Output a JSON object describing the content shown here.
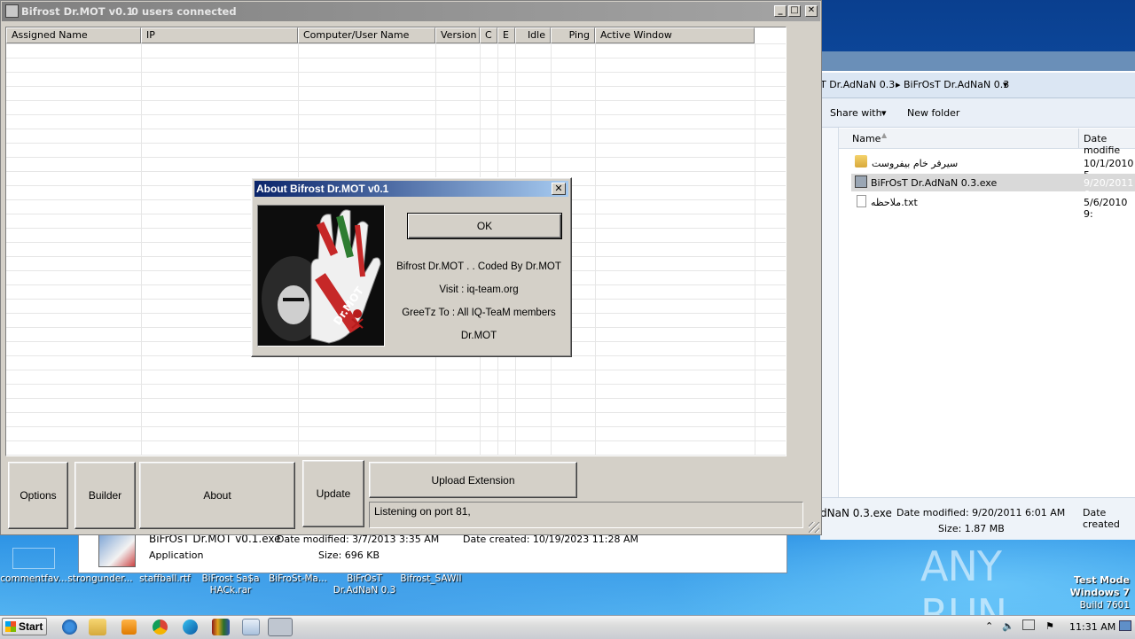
{
  "main_window": {
    "title": "Bifrost Dr.MOT v0.1",
    "users_connected": "0 users connected",
    "columns": [
      "Assigned Name",
      "IP",
      "Computer/User Name",
      "Version",
      "C",
      "E",
      "Idle",
      "Ping",
      "Active Window"
    ],
    "buttons": {
      "options": "Options",
      "builder": "Builder",
      "about": "About",
      "update": "Update",
      "upload_extension": "Upload Extension"
    },
    "status": "Listening on port 81,"
  },
  "about_dialog": {
    "title": "About Bifrost Dr.MOT v0.1",
    "ok": "OK",
    "lines": [
      "Bifrost Dr.MOT . . Coded By Dr.MOT",
      "Visit : iq-team.org",
      "GreeTz To : All IQ-TeaM members",
      "Dr.MOT"
    ]
  },
  "explorer": {
    "breadcrumb": [
      "T Dr.AdNaN 0.3",
      "BiFrOsT Dr.AdNaN 0.3"
    ],
    "toolbar": {
      "share": "Share with",
      "new_folder": "New folder"
    },
    "headers": {
      "name": "Name",
      "date": "Date modifie"
    },
    "files": [
      {
        "name": "سيرفر خام بيفروست",
        "date": "10/1/2010 5",
        "icon": "folder-icon"
      },
      {
        "name": "BiFrOsT Dr.AdNaN 0.3.exe",
        "date": "9/20/2011 6",
        "icon": "exe-icon"
      },
      {
        "name": "ملاحظه.txt",
        "date": "5/6/2010 9:",
        "icon": "txt-icon"
      }
    ],
    "details": {
      "name": "dNaN 0.3.exe",
      "modified_label": "Date modified: 9/20/2011 6:01 AM",
      "created_label": "Date created",
      "size": "Size: 1.87 MB"
    }
  },
  "explorer2_details": {
    "name": "BiFrOsT Dr.MOT v0.1.exe",
    "modified": "Date modified: 3/7/2013 3:35 AM",
    "created": "Date created: 10/19/2023 11:28 AM",
    "type": "Application",
    "size": "Size: 696 KB"
  },
  "desktop_icons": [
    {
      "label": "commentfav..."
    },
    {
      "label": "strongunder..."
    },
    {
      "label": "staffball.rtf"
    },
    {
      "label": "BiFrost Sa$a HACk.rar"
    },
    {
      "label": "BiFroSt-Ma..."
    },
    {
      "label": "BiFrOsT Dr.AdNaN 0.3"
    },
    {
      "label": "Bifrost_SAWII"
    }
  ],
  "watermark": {
    "brand": "ANY RUN"
  },
  "os_info": {
    "line1": "Test Mode",
    "line2": "Windows 7",
    "line3": "Build 7601"
  },
  "taskbar": {
    "start": "Start",
    "clock": "11:31 AM"
  },
  "colors": {
    "title_active": "#0a246a",
    "title_inactive": "#808080",
    "face": "#d4d0c8",
    "desktop": "#1468c8"
  }
}
